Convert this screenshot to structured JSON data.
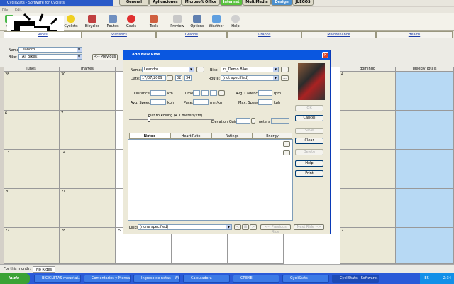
{
  "window": {
    "title": "CycliStats - Software for Cyclists"
  },
  "top_tabs": [
    "General",
    "Aplicaciones",
    "Microsoft Office",
    "Internet",
    "MultiMedia",
    "Design",
    "JUEGOS"
  ],
  "menu": [
    "File",
    "Edit"
  ],
  "toolbar": {
    "items": [
      "New",
      "Cyclists",
      "Bicycles",
      "Routes",
      "Goals",
      "Tools",
      "Preview",
      "Options",
      "Weather",
      "Help"
    ]
  },
  "nav_tabs": [
    "Rides",
    "Statistics",
    "Graphs",
    "Maintenance",
    "Health"
  ],
  "filters": {
    "name_label": "Name:",
    "name_value": "Leandro",
    "bike_label": "Bike:",
    "bike_value": "(All Bikes)",
    "prev_label": "<-- Previous"
  },
  "calendar": {
    "headers": [
      "lunes",
      "martes",
      "",
      "",
      "",
      "domingo",
      "Weekly Totals"
    ],
    "row_dates": [
      [
        "28",
        "30",
        "",
        "",
        "",
        "4"
      ],
      [
        "6",
        "7",
        "",
        "",
        "",
        ""
      ],
      [
        "13",
        "14",
        "",
        "",
        "",
        ""
      ],
      [
        "20",
        "21",
        "",
        "",
        "",
        ""
      ],
      [
        "27",
        "28",
        "29",
        "",
        "",
        "2"
      ]
    ]
  },
  "status": {
    "label": "For this month:",
    "value": "No Rides"
  },
  "dialog": {
    "title": "Add New Ride",
    "name_label": "Name:",
    "name_value": "Leandro",
    "browse": "...",
    "bike_label": "Bike:",
    "bike_value": "zz_Demo Bike",
    "date_label": "Date:",
    "date_value": "17/07/2009",
    "hour": "02",
    "minute": "34",
    "route_label": "Route:",
    "route_value": "(not specified)",
    "distance_label": "Distance:",
    "distance_unit": "km",
    "time_label": "Time:",
    "avg_cadence_label": "Avg. Cadence:",
    "avg_cadence_unit": "rpm",
    "avg_speed_label": "Avg. Speed:",
    "avg_speed_unit": "kph",
    "pace_label": "Pace:",
    "pace_unit": "min/km",
    "max_speed_label": "Max. Speed:",
    "max_speed_unit": "kph",
    "terrain": "Flat to Rolling (4.7 meters/km)",
    "elevation_label": "Elevation Gain:",
    "elevation_unit": "meters",
    "tabs": [
      "Notes",
      "Heart Rate",
      "Ratings",
      "Energy"
    ],
    "buttons": {
      "ok": "OK",
      "cancel": "Cancel",
      "save": "Save",
      "clear": "Clear",
      "delete": "Delete",
      "help": "Help",
      "print": "Print"
    },
    "links_label": "Links:",
    "links_value": "(none specified)",
    "prev_ride": "<-- Previous Ride",
    "next_ride": "Next Ride -->"
  },
  "taskbar": {
    "start": "Inicio",
    "tasks": [
      "BICICLETAS mountai...",
      "Comentarios y Mensa...",
      "Ingreso de notas - Wi...",
      "Calculadora",
      "CREXE",
      "CycliStats",
      "CycliStats - Software ..."
    ],
    "lang": "ES",
    "time": "2:34"
  },
  "colors": {
    "accent": "#0a57e0",
    "weekly_totals": "#b7d9f4"
  }
}
